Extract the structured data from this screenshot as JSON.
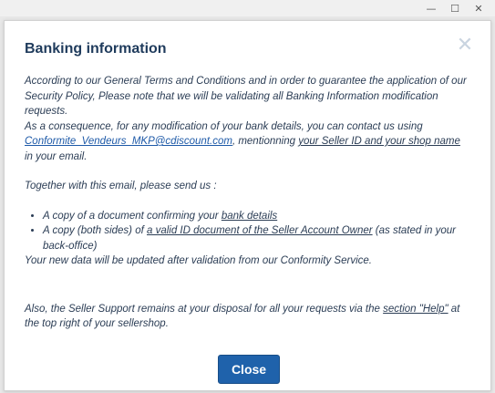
{
  "window": {
    "minimize_glyph": "—",
    "maximize_glyph": "☐",
    "close_glyph": "✕"
  },
  "dialog": {
    "title": "Banking information",
    "close_glyph": "✕",
    "para1": "According to our General Terms and Conditions and in order to guarantee the application of our Security Policy, Please note that we will be validating all Banking Information modification requests.",
    "para2_start": "As a consequence, for any modification of your bank details, you can contact us using ",
    "email_link": "Conformite_Vendeurs_MKP@cdiscount.com",
    "para2_mid": ", mentionning ",
    "seller_id_text": "your Seller ID and your shop name",
    "para2_end": " in your email.",
    "para3": "Together with this email, please send us :",
    "bullet1_start": "A copy of a document confirming your ",
    "bullet1_link": "bank details",
    "bullet2_start": "A copy (both sides) of ",
    "bullet2_link": "a valid ID document of the Seller Account Owner",
    "bullet2_end": " (as stated in your back-office)",
    "para4": "Your new data will be updated after validation from our Conformity Service.",
    "para5_start": "Also, the Seller Support remains at your disposal for all your requests via the ",
    "help_link": "section \"Help\"",
    "para5_end": " at the top right of your sellershop.",
    "close_button_label": "Close"
  },
  "colors": {
    "title": "#1f3b5c",
    "body_text": "#2b3d55",
    "link": "#1e5aa8",
    "button": "#1f62ab"
  }
}
